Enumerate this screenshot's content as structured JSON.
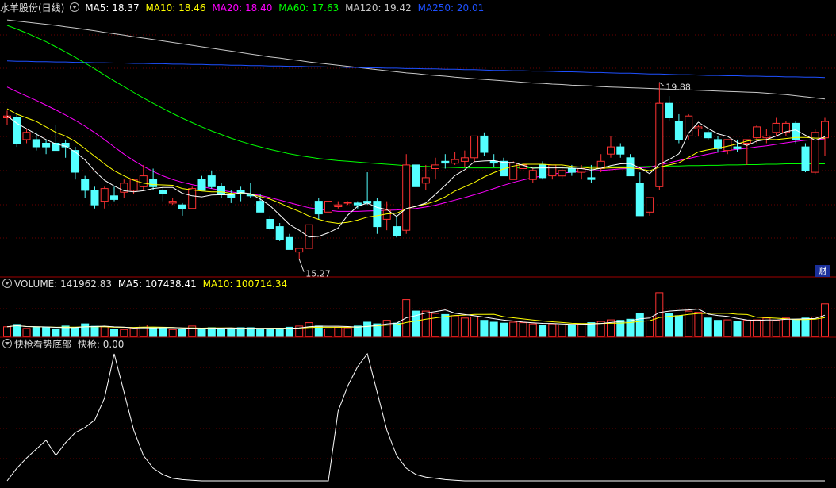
{
  "header": {
    "stock": "水羊股份(日线)",
    "ma": [
      {
        "label": "MA5: 18.37",
        "color": "#ffffff"
      },
      {
        "label": "MA10: 18.46",
        "color": "#ffff00"
      },
      {
        "label": "MA20: 18.40",
        "color": "#ff00ff"
      },
      {
        "label": "MA60: 17.63",
        "color": "#00ff00"
      },
      {
        "label": "MA120: 19.42",
        "color": "#c8c8c8"
      },
      {
        "label": "MA250: 20.01",
        "color": "#1e50ff"
      }
    ]
  },
  "volume_header": {
    "label": "VOLUME: 141962.83",
    "ma5": "MA5: 107438.41",
    "ma10": "MA10: 100714.34"
  },
  "indicator_header": {
    "name": "快枪看势底部",
    "value": "快枪: 0.00"
  },
  "badge": "财",
  "colors": {
    "up": "#ff3232",
    "down": "#54ffff",
    "ma5": "#ffffff",
    "ma10": "#ffff00",
    "ma20": "#ff00ff",
    "ma60": "#00ff00",
    "ma120": "#c8c8c8",
    "ma250": "#1e50ff"
  },
  "chart_data": [
    {
      "type": "candlestick",
      "annotations": [
        {
          "text": "19.88",
          "at": "high"
        },
        {
          "text": "15.27",
          "at": "low"
        }
      ],
      "candles": [
        [
          18.9,
          19.1,
          18.7,
          18.95
        ],
        [
          18.9,
          19.0,
          18.1,
          18.2
        ],
        [
          18.3,
          18.6,
          18.2,
          18.5
        ],
        [
          18.3,
          18.5,
          18.0,
          18.1
        ],
        [
          18.2,
          18.3,
          17.9,
          18.1
        ],
        [
          18.2,
          18.7,
          18.1,
          18.0
        ],
        [
          18.2,
          18.3,
          17.8,
          18.1
        ],
        [
          18.0,
          18.1,
          17.2,
          17.4
        ],
        [
          17.2,
          17.3,
          16.7,
          16.9
        ],
        [
          16.9,
          17.0,
          16.4,
          16.5
        ],
        [
          16.6,
          17.0,
          16.4,
          16.95
        ],
        [
          16.75,
          17.0,
          16.6,
          16.65
        ],
        [
          16.85,
          17.2,
          16.7,
          17.1
        ],
        [
          16.9,
          17.2,
          16.8,
          17.2
        ],
        [
          17.0,
          17.6,
          16.9,
          17.3
        ],
        [
          17.2,
          17.5,
          16.9,
          17.0
        ],
        [
          16.9,
          17.0,
          16.6,
          16.8
        ],
        [
          16.55,
          16.7,
          16.5,
          16.6
        ],
        [
          16.5,
          16.55,
          16.2,
          16.4
        ],
        [
          16.4,
          17.0,
          16.4,
          16.95
        ],
        [
          17.2,
          17.3,
          16.9,
          16.9
        ],
        [
          17.3,
          17.45,
          16.95,
          17.0
        ],
        [
          17.0,
          17.1,
          16.7,
          16.8
        ],
        [
          16.8,
          16.9,
          16.55,
          16.7
        ],
        [
          16.9,
          17.0,
          16.6,
          16.8
        ],
        [
          16.8,
          17.1,
          16.7,
          16.75
        ],
        [
          16.6,
          16.8,
          16.3,
          16.3
        ],
        [
          16.1,
          16.2,
          15.8,
          15.85
        ],
        [
          15.9,
          16.0,
          15.5,
          15.55
        ],
        [
          15.6,
          15.7,
          15.3,
          15.27
        ],
        [
          15.2,
          15.3,
          15.0,
          15.3
        ],
        [
          15.3,
          16.0,
          15.2,
          15.95
        ],
        [
          16.6,
          16.7,
          16.1,
          16.25
        ],
        [
          16.3,
          16.6,
          16.3,
          16.6
        ],
        [
          16.45,
          16.6,
          16.4,
          16.5
        ],
        [
          16.55,
          16.6,
          16.5,
          16.57
        ],
        [
          16.55,
          16.6,
          16.4,
          16.5
        ],
        [
          16.6,
          17.4,
          16.5,
          16.55
        ],
        [
          16.6,
          16.7,
          15.7,
          15.9
        ],
        [
          16.1,
          16.6,
          15.8,
          16.35
        ],
        [
          15.9,
          16.2,
          15.6,
          15.65
        ],
        [
          15.8,
          17.9,
          15.7,
          17.6
        ],
        [
          17.6,
          17.8,
          16.9,
          17.0
        ],
        [
          17.1,
          17.6,
          16.9,
          17.25
        ],
        [
          17.5,
          17.8,
          17.2,
          17.6
        ],
        [
          17.7,
          17.9,
          17.5,
          17.65
        ],
        [
          17.65,
          17.95,
          17.6,
          17.75
        ],
        [
          17.7,
          18.0,
          17.55,
          17.8
        ],
        [
          17.8,
          18.4,
          17.7,
          18.4
        ],
        [
          18.4,
          18.5,
          17.85,
          17.95
        ],
        [
          17.7,
          17.9,
          17.55,
          17.65
        ],
        [
          17.7,
          17.8,
          17.3,
          17.3
        ],
        [
          17.2,
          17.7,
          17.2,
          17.65
        ],
        [
          17.5,
          17.7,
          17.5,
          17.6
        ],
        [
          17.2,
          17.5,
          17.1,
          17.45
        ],
        [
          17.6,
          17.7,
          17.2,
          17.25
        ],
        [
          17.3,
          17.6,
          17.2,
          17.6
        ],
        [
          17.3,
          17.6,
          17.2,
          17.45
        ],
        [
          17.5,
          17.6,
          17.3,
          17.4
        ],
        [
          17.4,
          17.6,
          17.2,
          17.5
        ],
        [
          17.25,
          17.6,
          17.1,
          17.2
        ],
        [
          17.5,
          17.9,
          17.4,
          17.7
        ],
        [
          17.9,
          18.4,
          17.8,
          18.1
        ],
        [
          18.1,
          18.2,
          17.8,
          17.9
        ],
        [
          17.8,
          17.9,
          17.3,
          17.3
        ],
        [
          17.1,
          17.4,
          16.2,
          16.2
        ],
        [
          16.3,
          16.5,
          16.2,
          16.7
        ],
        [
          17.0,
          19.88,
          16.9,
          19.3
        ],
        [
          19.3,
          19.5,
          18.8,
          18.9
        ],
        [
          18.8,
          19.0,
          18.2,
          18.3
        ],
        [
          18.4,
          19.0,
          18.3,
          18.95
        ],
        [
          18.6,
          18.7,
          18.4,
          18.65
        ],
        [
          18.5,
          18.55,
          18.3,
          18.35
        ],
        [
          18.3,
          18.4,
          17.95,
          18.05
        ],
        [
          18.0,
          18.3,
          17.9,
          18.3
        ],
        [
          18.1,
          18.3,
          17.95,
          18.05
        ],
        [
          18.2,
          18.3,
          17.6,
          18.3
        ],
        [
          18.35,
          18.7,
          18.2,
          18.65
        ],
        [
          18.35,
          18.6,
          18.2,
          18.4
        ],
        [
          18.5,
          18.9,
          18.4,
          18.75
        ],
        [
          18.5,
          18.8,
          18.4,
          18.75
        ],
        [
          18.75,
          18.8,
          18.2,
          18.3
        ],
        [
          18.1,
          18.2,
          17.4,
          17.45
        ],
        [
          17.4,
          18.6,
          17.35,
          18.5
        ],
        [
          18.35,
          18.9,
          17.85,
          18.8
        ]
      ],
      "ma5": [
        18.95,
        18.75,
        18.6,
        18.45,
        18.3,
        18.18,
        18.12,
        17.96,
        17.74,
        17.43,
        17.18,
        17.02,
        16.89,
        16.86,
        16.89,
        16.95,
        16.98,
        16.98,
        16.82,
        16.75,
        16.72,
        16.77,
        16.78,
        16.77,
        16.84,
        16.81,
        16.66,
        16.48,
        16.22,
        15.96,
        15.8,
        15.61,
        15.63,
        15.73,
        15.86,
        16.22,
        16.46,
        16.55,
        16.43,
        16.37,
        16.18,
        16.4,
        16.46,
        16.55,
        16.79,
        17.04,
        17.31,
        17.47,
        17.69,
        17.71,
        17.72,
        17.67,
        17.67,
        17.59,
        17.51,
        17.52,
        17.52,
        17.52,
        17.51,
        17.5,
        17.46,
        17.51,
        17.58,
        17.63,
        17.64,
        17.52,
        17.36,
        17.62,
        17.75,
        17.91,
        18.48,
        18.78,
        18.61,
        18.46,
        18.39,
        18.22,
        18.14,
        18.26,
        18.3,
        18.4,
        18.52,
        18.57,
        18.42,
        18.28,
        18.38
      ],
      "ma10": [
        19.15,
        19.0,
        18.9,
        18.8,
        18.65,
        18.5,
        18.4,
        18.25,
        18.05,
        17.84,
        17.63,
        17.44,
        17.3,
        17.18,
        17.1,
        17.06,
        17.05,
        17.04,
        16.95,
        16.91,
        16.88,
        16.86,
        16.86,
        16.82,
        16.81,
        16.79,
        16.73,
        16.66,
        16.55,
        16.43,
        16.32,
        16.19,
        16.1,
        16.03,
        15.99,
        16.02,
        16.08,
        16.16,
        16.2,
        16.25,
        16.27,
        16.39,
        16.46,
        16.52,
        16.6,
        16.72,
        16.88,
        17.0,
        17.12,
        17.27,
        17.39,
        17.49,
        17.57,
        17.62,
        17.62,
        17.62,
        17.6,
        17.6,
        17.56,
        17.54,
        17.51,
        17.51,
        17.52,
        17.52,
        17.52,
        17.49,
        17.44,
        17.54,
        17.6,
        17.66,
        17.81,
        17.96,
        18.02,
        18.06,
        18.12,
        18.18,
        18.26,
        18.3,
        18.3,
        18.3,
        18.33,
        18.36,
        18.36,
        18.34,
        18.34
      ],
      "ma20": [
        19.75,
        19.62,
        19.5,
        19.38,
        19.25,
        19.12,
        18.98,
        18.83,
        18.67,
        18.49,
        18.3,
        18.1,
        17.9,
        17.72,
        17.56,
        17.42,
        17.3,
        17.2,
        17.12,
        17.06,
        17.0,
        16.95,
        16.9,
        16.86,
        16.82,
        16.8,
        16.76,
        16.7,
        16.63,
        16.56,
        16.49,
        16.42,
        16.38,
        16.35,
        16.32,
        16.32,
        16.32,
        16.33,
        16.34,
        16.35,
        16.36,
        16.38,
        16.4,
        16.44,
        16.49,
        16.56,
        16.63,
        16.7,
        16.78,
        16.86,
        16.95,
        17.04,
        17.12,
        17.19,
        17.25,
        17.3,
        17.35,
        17.38,
        17.4,
        17.42,
        17.44,
        17.45,
        17.47,
        17.49,
        17.5,
        17.52,
        17.54,
        17.6,
        17.66,
        17.72,
        17.78,
        17.84,
        17.9,
        17.95,
        18.0,
        18.03,
        18.06,
        18.1,
        18.13,
        18.17,
        18.21,
        18.25,
        18.28,
        18.3,
        18.32
      ],
      "ma60": [
        21.45,
        21.35,
        21.24,
        21.12,
        21.0,
        20.86,
        20.72,
        20.57,
        20.41,
        20.25,
        20.08,
        19.92,
        19.76,
        19.6,
        19.45,
        19.3,
        19.16,
        19.02,
        18.89,
        18.77,
        18.65,
        18.54,
        18.44,
        18.34,
        18.25,
        18.17,
        18.1,
        18.03,
        17.97,
        17.91,
        17.86,
        17.82,
        17.78,
        17.75,
        17.72,
        17.7,
        17.68,
        17.66,
        17.64,
        17.62,
        17.6,
        17.58,
        17.57,
        17.56,
        17.55,
        17.54,
        17.53,
        17.52,
        17.52,
        17.52,
        17.52,
        17.52,
        17.52,
        17.52,
        17.52,
        17.53,
        17.53,
        17.54,
        17.54,
        17.55,
        17.55,
        17.55,
        17.55,
        17.55,
        17.55,
        17.55,
        17.56,
        17.56,
        17.57,
        17.57,
        17.58,
        17.58,
        17.59,
        17.59,
        17.6,
        17.6,
        17.61,
        17.61,
        17.62,
        17.62,
        17.63,
        17.63,
        17.63,
        17.63,
        17.63
      ],
      "ma120": [
        21.6,
        21.57,
        21.54,
        21.51,
        21.48,
        21.45,
        21.41,
        21.38,
        21.34,
        21.3,
        21.26,
        21.22,
        21.18,
        21.14,
        21.1,
        21.06,
        21.02,
        20.98,
        20.94,
        20.9,
        20.86,
        20.82,
        20.78,
        20.74,
        20.7,
        20.66,
        20.62,
        20.58,
        20.55,
        20.51,
        20.48,
        20.44,
        20.41,
        20.38,
        20.35,
        20.32,
        20.29,
        20.26,
        20.23,
        20.2,
        20.17,
        20.14,
        20.12,
        20.09,
        20.07,
        20.05,
        20.02,
        20.0,
        19.98,
        19.96,
        19.94,
        19.92,
        19.9,
        19.88,
        19.86,
        19.85,
        19.83,
        19.82,
        19.8,
        19.79,
        19.78,
        19.76,
        19.75,
        19.74,
        19.73,
        19.72,
        19.71,
        19.7,
        19.69,
        19.68,
        19.67,
        19.66,
        19.65,
        19.64,
        19.63,
        19.62,
        19.61,
        19.6,
        19.58,
        19.56,
        19.54,
        19.51,
        19.48,
        19.45,
        19.42
      ],
      "ma250": [
        20.47,
        20.46,
        20.46,
        20.45,
        20.45,
        20.44,
        20.44,
        20.43,
        20.43,
        20.42,
        20.42,
        20.41,
        20.41,
        20.4,
        20.4,
        20.39,
        20.39,
        20.38,
        20.38,
        20.37,
        20.37,
        20.36,
        20.36,
        20.35,
        20.35,
        20.34,
        20.34,
        20.33,
        20.33,
        20.32,
        20.32,
        20.31,
        20.31,
        20.3,
        20.3,
        20.29,
        20.29,
        20.28,
        20.28,
        20.27,
        20.27,
        20.26,
        20.26,
        20.25,
        20.25,
        20.24,
        20.24,
        20.23,
        20.23,
        20.22,
        20.21,
        20.21,
        20.2,
        20.2,
        20.19,
        20.19,
        20.18,
        20.17,
        20.17,
        20.16,
        20.15,
        20.15,
        20.14,
        20.13,
        20.13,
        20.12,
        20.11,
        20.11,
        20.1,
        20.09,
        20.09,
        20.08,
        20.07,
        20.07,
        20.06,
        20.06,
        20.05,
        20.05,
        20.04,
        20.04,
        20.03,
        20.03,
        20.02,
        20.02,
        20.01
      ]
    },
    {
      "type": "bar",
      "name": "VOLUME",
      "ma5_color": "#ffffff",
      "ma10_color": "#ffff00",
      "values": [
        42000,
        52000,
        35000,
        40000,
        38000,
        33000,
        45000,
        38000,
        55000,
        44000,
        42000,
        30000,
        30000,
        37000,
        50000,
        38000,
        36000,
        30000,
        30000,
        45000,
        36000,
        38000,
        32000,
        34000,
        38000,
        38000,
        34000,
        32000,
        34000,
        40000,
        45000,
        60000,
        45000,
        33000,
        40000,
        38000,
        45000,
        62000,
        55000,
        70000,
        58000,
        160000,
        110000,
        110000,
        100000,
        95000,
        90000,
        80000,
        85000,
        70000,
        62000,
        58000,
        62000,
        60000,
        55000,
        50000,
        55000,
        50000,
        52000,
        55000,
        60000,
        65000,
        72000,
        70000,
        75000,
        100000,
        85000,
        190000,
        100000,
        90000,
        110000,
        105000,
        80000,
        70000,
        72000,
        65000,
        70000,
        72000,
        80000,
        70000,
        80000,
        75000,
        80000,
        85000,
        141962.83
      ]
    },
    {
      "type": "line",
      "name": "快枪看势底部",
      "range": [
        0,
        100
      ],
      "values": [
        0,
        10,
        18,
        25,
        32,
        20,
        30,
        38,
        42,
        48,
        65,
        100,
        70,
        40,
        20,
        10,
        5,
        2,
        1,
        0.5,
        0,
        0,
        0,
        0,
        0,
        0,
        0,
        0,
        0,
        0,
        0,
        0,
        0,
        0,
        0,
        0,
        0,
        0,
        0,
        0,
        0,
        0,
        0,
        0,
        0,
        0,
        0,
        0,
        0,
        0,
        0,
        0,
        0,
        0,
        0,
        0,
        0,
        0,
        0,
        0,
        0,
        0,
        0,
        0,
        0,
        0,
        0,
        0,
        0,
        0,
        0,
        0,
        0,
        0,
        0,
        0,
        0,
        0,
        0,
        0,
        0,
        0,
        0,
        0,
        0
      ],
      "series2_hint": "second peak",
      "values2": [
        0,
        0,
        0,
        0,
        0,
        0,
        0,
        0,
        0,
        0,
        0,
        0,
        0,
        0,
        0,
        0,
        0,
        0,
        0,
        0,
        0,
        0,
        0,
        0,
        0,
        0,
        0,
        0,
        0,
        0,
        0,
        0,
        0,
        0,
        55,
        75,
        90,
        100,
        70,
        40,
        20,
        10,
        5,
        3,
        2,
        1,
        0.5,
        0,
        0,
        0,
        0,
        0,
        0,
        0,
        0,
        0,
        0,
        0,
        0,
        0,
        0,
        0,
        0,
        0,
        0,
        0,
        0,
        0,
        0,
        0,
        0,
        0,
        0,
        0,
        0,
        0,
        0,
        0,
        0,
        0,
        0,
        0,
        0,
        0,
        0
      ]
    }
  ]
}
